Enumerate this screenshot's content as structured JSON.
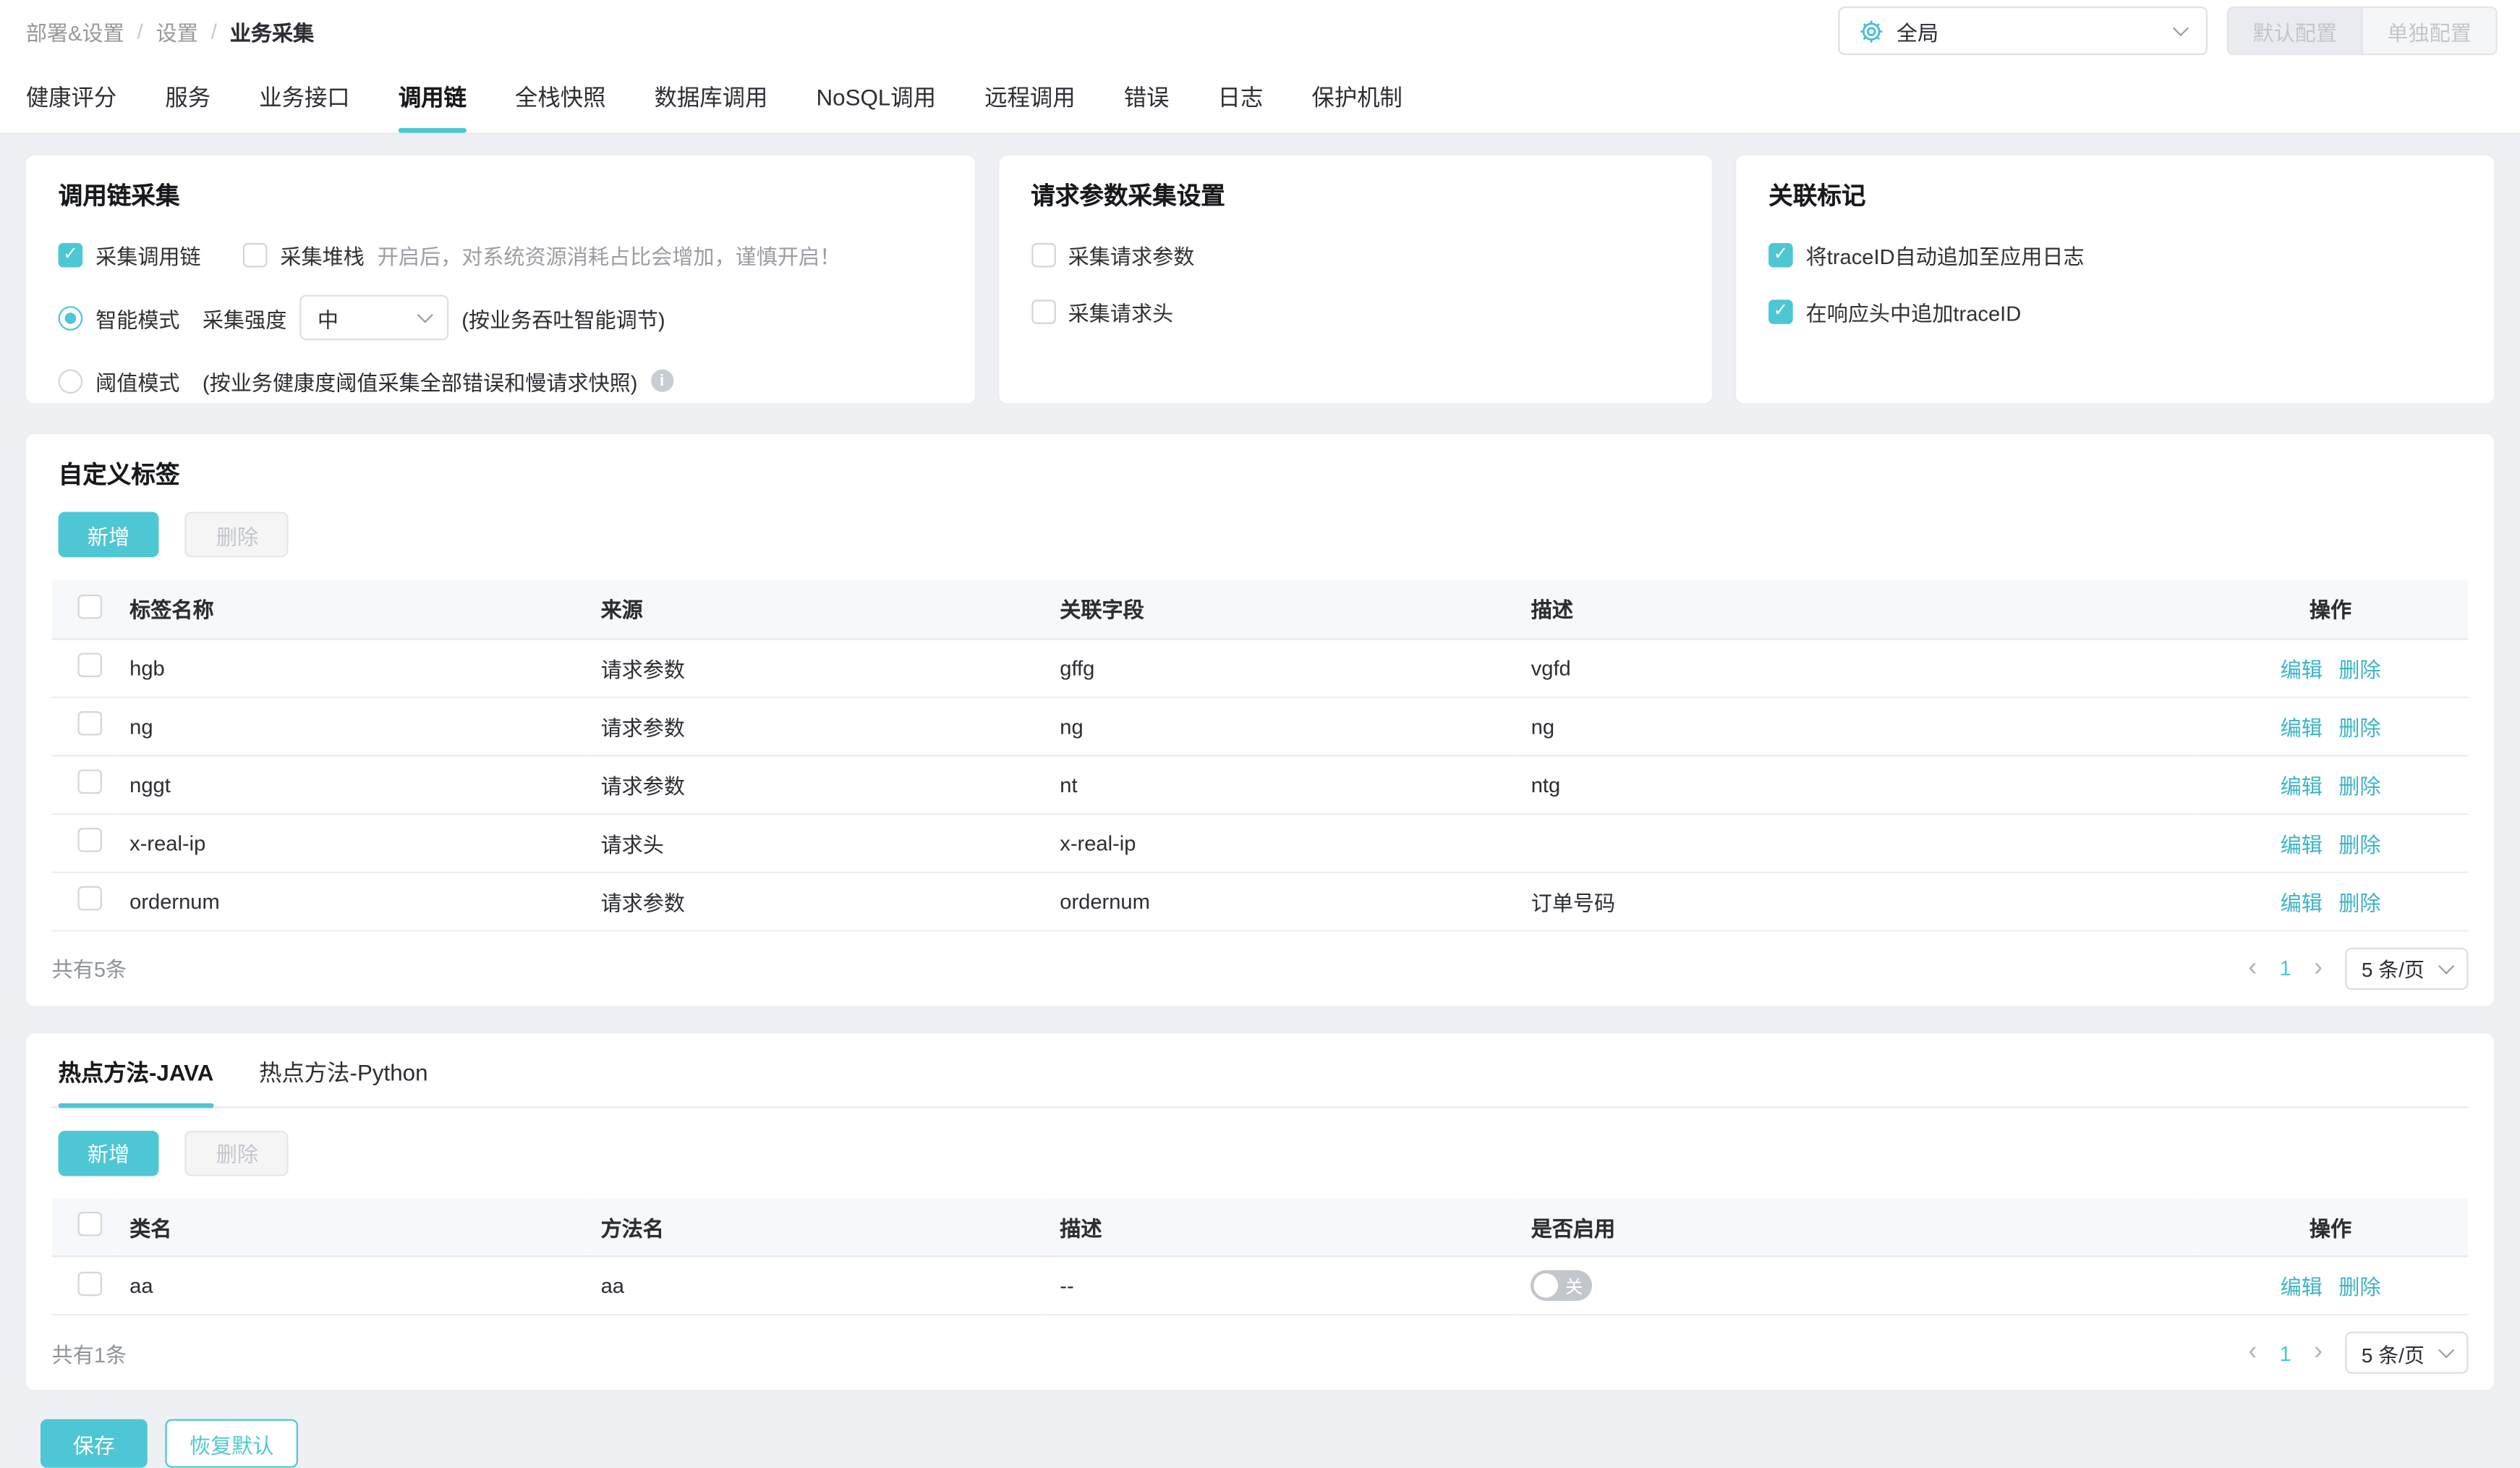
{
  "colors": {
    "accent": "#4dc7d3",
    "link": "#3cb4c7",
    "page_bg": "#eef0f4"
  },
  "breadcrumb": {
    "items": [
      "部署&设置",
      "设置",
      "业务采集"
    ],
    "separator": "/"
  },
  "header": {
    "scope_select": {
      "value": "全局",
      "icon": "gear-icon"
    },
    "config_buttons": [
      "默认配置",
      "单独配置"
    ]
  },
  "tabs": {
    "items": [
      "健康评分",
      "服务",
      "业务接口",
      "调用链",
      "全栈快照",
      "数据库调用",
      "NoSQL调用",
      "远程调用",
      "错误",
      "日志",
      "保护机制"
    ],
    "active": "调用链"
  },
  "panels": {
    "trace_collection": {
      "title": "调用链采集",
      "collect_trace_label": "采集调用链",
      "collect_trace_checked": true,
      "collect_stack_label": "采集堆栈",
      "collect_stack_checked": false,
      "stack_hint": "开启后，对系统资源消耗占比会增加，谨慎开启！",
      "smart_mode_label": "智能模式",
      "smart_mode_selected": true,
      "intensity_label": "采集强度",
      "intensity_value": "中",
      "smart_hint": "(按业务吞吐智能调节)",
      "threshold_mode_label": "阈值模式",
      "threshold_mode_selected": false,
      "threshold_hint": "(按业务健康度阈值采集全部错误和慢请求快照)",
      "info_icon": "i"
    },
    "request_params": {
      "title": "请求参数采集设置",
      "options": [
        {
          "label": "采集请求参数",
          "checked": false
        },
        {
          "label": "采集请求头",
          "checked": false
        }
      ]
    },
    "trace_mark": {
      "title": "关联标记",
      "options": [
        {
          "label": "将traceID自动追加至应用日志",
          "checked": true
        },
        {
          "label": "在响应头中追加traceID",
          "checked": true
        }
      ]
    }
  },
  "custom_tags": {
    "title": "自定义标签",
    "add_label": "新增",
    "delete_label": "删除",
    "columns": [
      "标签名称",
      "来源",
      "关联字段",
      "描述",
      "操作"
    ],
    "rows": [
      {
        "name": "hgb",
        "source": "请求参数",
        "field": "gffg",
        "desc": "vgfd"
      },
      {
        "name": "ng",
        "source": "请求参数",
        "field": "ng",
        "desc": "ng"
      },
      {
        "name": "nggt",
        "source": "请求参数",
        "field": "nt",
        "desc": "ntg"
      },
      {
        "name": "x-real-ip",
        "source": "请求头",
        "field": "x-real-ip",
        "desc": ""
      },
      {
        "name": "ordernum",
        "source": "请求参数",
        "field": "ordernum",
        "desc": "订单号码"
      }
    ],
    "edit_label": "编辑",
    "del_label": "删除",
    "total_text": "共有5条",
    "pagination": {
      "prev": "‹",
      "current": "1",
      "next": "›",
      "page_size": "5 条/页"
    }
  },
  "hot_methods": {
    "tabs": [
      "热点方法-JAVA",
      "热点方法-Python"
    ],
    "active_tab": "热点方法-JAVA",
    "add_label": "新增",
    "delete_label": "删除",
    "columns": [
      "类名",
      "方法名",
      "描述",
      "是否启用",
      "操作"
    ],
    "rows": [
      {
        "class_name": "aa",
        "method": "aa",
        "desc": "--",
        "enabled": false,
        "toggle_label": "关"
      }
    ],
    "edit_label": "编辑",
    "del_label": "删除",
    "total_text": "共有1条",
    "pagination": {
      "prev": "‹",
      "current": "1",
      "next": "›",
      "page_size": "5 条/页"
    }
  },
  "footer": {
    "save_label": "保存",
    "reset_label": "恢复默认"
  }
}
